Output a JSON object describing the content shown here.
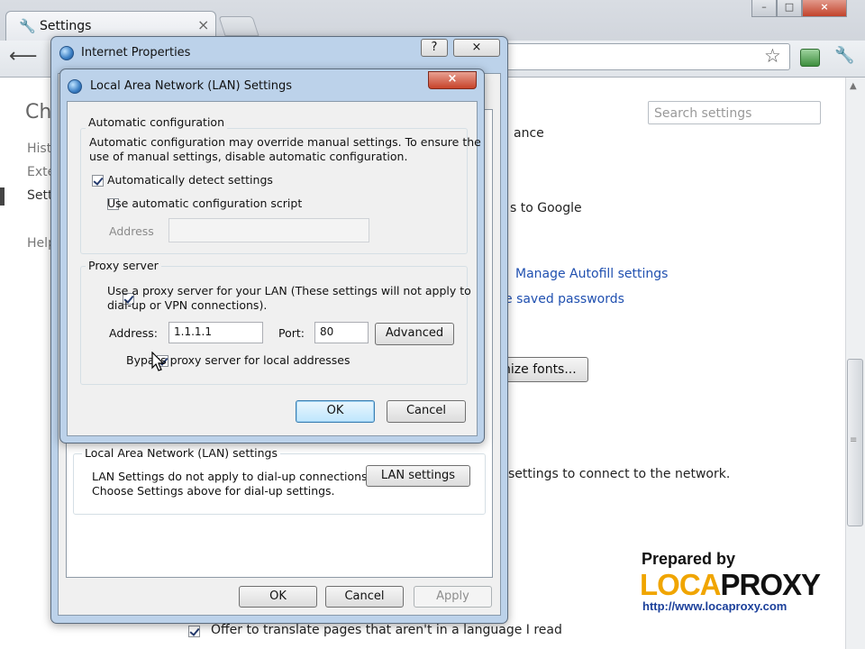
{
  "browser": {
    "tab_title": "Settings",
    "tab_close": "×",
    "window_controls": [
      "–",
      "□",
      "×"
    ]
  },
  "settings_page": {
    "heading_partial": "Ch",
    "nav": [
      "Hist",
      "Exte",
      "Sett",
      "Help"
    ],
    "search_placeholder": "Search settings",
    "fragment_ance": "ance",
    "send_to_google": "s to Google",
    "manage_autofill": "Manage Autofill settings",
    "saved_passwords": "e saved passwords",
    "customize_fonts": "mize fonts...",
    "network_text": "settings to connect to the network.",
    "translate_offer": "Offer to translate pages that aren't in a language I read"
  },
  "internet_properties": {
    "title": "Internet Properties",
    "help_btn": "?",
    "close_btn": "×",
    "lan_group_label": "Local Area Network (LAN) settings",
    "lan_text_1": "LAN Settings do not apply to dial-up connections.",
    "lan_text_2": "Choose Settings above for dial-up settings.",
    "lan_settings_btn": "LAN settings",
    "ok": "OK",
    "cancel": "Cancel",
    "apply": "Apply"
  },
  "lan_dialog": {
    "title": "Local Area Network (LAN) Settings",
    "close_btn": "×",
    "auto_config_label": "Automatic configuration",
    "auto_config_desc_1": "Automatic configuration may override manual settings.  To ensure the",
    "auto_config_desc_2": "use of manual settings, disable automatic configuration.",
    "auto_detect_label": "Automatically detect settings",
    "auto_detect_checked": true,
    "use_script_label": "Use automatic configuration script",
    "use_script_checked": false,
    "script_address_label": "Address",
    "script_address_value": "",
    "proxy_group_label": "Proxy server",
    "use_proxy_label_1": "Use a proxy server for your LAN (These settings will not apply to",
    "use_proxy_label_2": "dial-up or VPN connections).",
    "use_proxy_checked": true,
    "proxy_address_label": "Address:",
    "proxy_address_value": "1.1.1.1",
    "port_label": "Port:",
    "port_value": "80",
    "advanced_btn": "Advanced",
    "bypass_label": "Bypass proxy server for local addresses",
    "bypass_checked": true,
    "ok": "OK",
    "cancel": "Cancel"
  },
  "watermark": {
    "prepared_by": "Prepared by",
    "brand_loca": "LOCA",
    "brand_proxy": "PROXY",
    "url": "http://www.locaproxy.com"
  },
  "colors": {
    "brand_orange": "#f0a500",
    "brand_dark": "#111111",
    "link_blue": "#2050b0",
    "url_blue": "#1a3f9a"
  }
}
